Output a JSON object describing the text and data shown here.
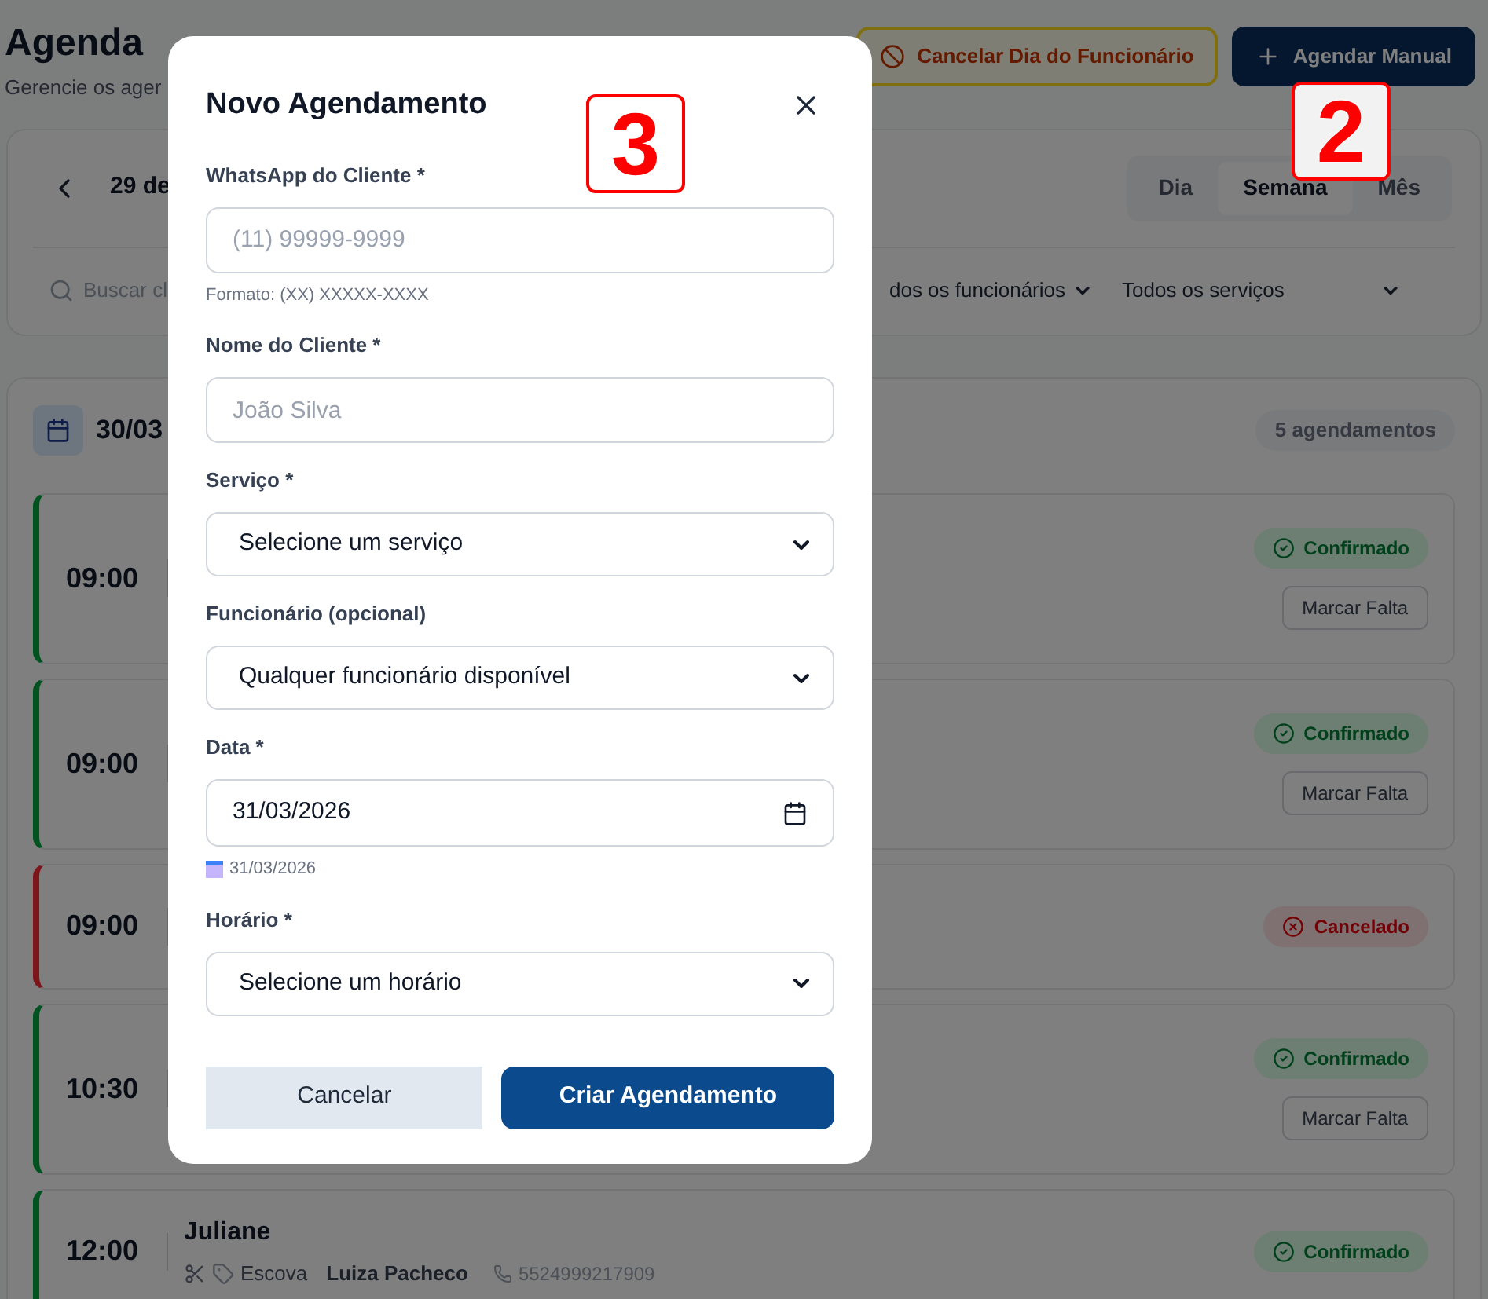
{
  "header": {
    "title": "Agenda",
    "subtitle": "Gerencie os ager",
    "buttons": [
      {
        "kind": "outline",
        "label": "Cancelar Dia do Funcionário"
      },
      {
        "kind": "primary",
        "label": "Agendar Manual"
      }
    ]
  },
  "filters": {
    "date": "29 de",
    "views": [
      {
        "label": "Dia",
        "selected": false
      },
      {
        "label": "Semana",
        "selected": true
      },
      {
        "label": "Mês",
        "selected": false
      }
    ],
    "search": {
      "placeholder": "Buscar cl"
    },
    "employee_filter": "dos os funcionários",
    "service_filter": "Todos os serviços"
  },
  "day": {
    "date": "30/03",
    "count": "5 agendamentos",
    "appointments": [
      {
        "time": "09:00",
        "kind": "confirmed",
        "badge": "Confirmado",
        "action": "Marcar Falta"
      },
      {
        "time": "09:00",
        "kind": "confirmed",
        "badge": "Confirmado",
        "action": "Marcar Falta"
      },
      {
        "time": "09:00",
        "kind": "cancelled",
        "badge": "Cancelado"
      },
      {
        "time": "10:30",
        "kind": "confirmed",
        "badge": "Confirmado",
        "action": "Marcar Falta"
      },
      {
        "time": "12:00",
        "kind": "confirmed",
        "badge": "Confirmado",
        "client": "Juliane",
        "service": "Escova",
        "employee": "Luiza Pacheco",
        "phone": "5524999217909"
      }
    ]
  },
  "dialog": {
    "title": "Novo Agendamento",
    "fields": [
      {
        "kind": "text",
        "label": "WhatsApp do Cliente *",
        "placeholder": "(11) 99999-9999",
        "help": "Formato: (XX) XXXXX-XXXX"
      },
      {
        "kind": "text",
        "label": "Nome do Cliente *",
        "placeholder": "João Silva"
      },
      {
        "kind": "select",
        "label": "Serviço *",
        "value": "Selecione um serviço"
      },
      {
        "kind": "select",
        "label": "Funcionário (opcional)",
        "value": "Qualquer funcionário disponível"
      },
      {
        "kind": "date",
        "label": "Data *",
        "value": "31/03/2026",
        "help": "31/03/2026"
      },
      {
        "kind": "select",
        "label": "Horário *",
        "value": "Selecione um horário"
      }
    ],
    "buttons": [
      {
        "kind": "secondary",
        "label": "Cancelar"
      },
      {
        "kind": "primary",
        "label": "Criar Agendamento"
      }
    ]
  },
  "annotations": [
    {
      "label": "3"
    },
    {
      "label": "2"
    }
  ]
}
